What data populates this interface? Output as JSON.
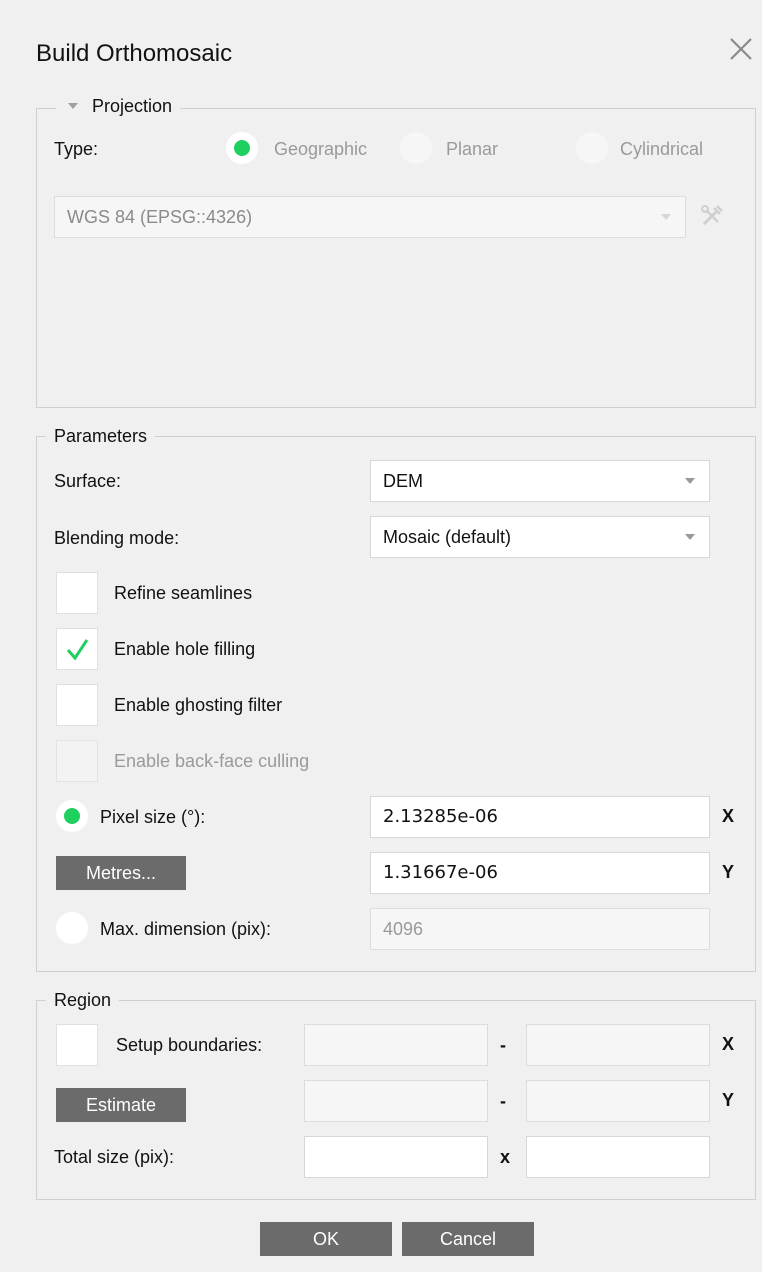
{
  "dialog": {
    "title": "Build Orthomosaic"
  },
  "projection": {
    "legend": "Projection",
    "type_label": "Type:",
    "options": [
      "Geographic",
      "Planar",
      "Cylindrical"
    ],
    "selected": "Geographic",
    "crs_value": "WGS 84 (EPSG::4326)"
  },
  "parameters": {
    "legend": "Parameters",
    "surface_label": "Surface:",
    "surface_value": "DEM",
    "blending_label": "Blending mode:",
    "blending_value": "Mosaic (default)",
    "checkboxes": [
      {
        "label": "Refine seamlines",
        "checked": false,
        "enabled": true
      },
      {
        "label": "Enable hole filling",
        "checked": true,
        "enabled": true
      },
      {
        "label": "Enable ghosting filter",
        "checked": false,
        "enabled": true
      },
      {
        "label": "Enable back-face culling",
        "checked": false,
        "enabled": false
      }
    ],
    "pixel_size_label": "Pixel size (°):",
    "pixel_size_x": "2.13285e-06",
    "pixel_size_y": "1.31667e-06",
    "metres_button": "Metres...",
    "max_dimension_label": "Max. dimension (pix):",
    "max_dimension_value": "4096",
    "axis_x": "X",
    "axis_y": "Y"
  },
  "region": {
    "legend": "Region",
    "setup_label": "Setup boundaries:",
    "estimate_button": "Estimate",
    "total_size_label": "Total size (pix):",
    "range_sep": "-",
    "size_sep": "x",
    "axis_x": "X",
    "axis_y": "Y",
    "x_min": "",
    "x_max": "",
    "y_min": "",
    "y_max": "",
    "total_w": "",
    "total_h": ""
  },
  "footer": {
    "ok_label": "OK",
    "cancel_label": "Cancel"
  },
  "colors": {
    "accent": "#1fcf5f",
    "button": "#6b6b6b",
    "background": "#f0f0f0"
  }
}
